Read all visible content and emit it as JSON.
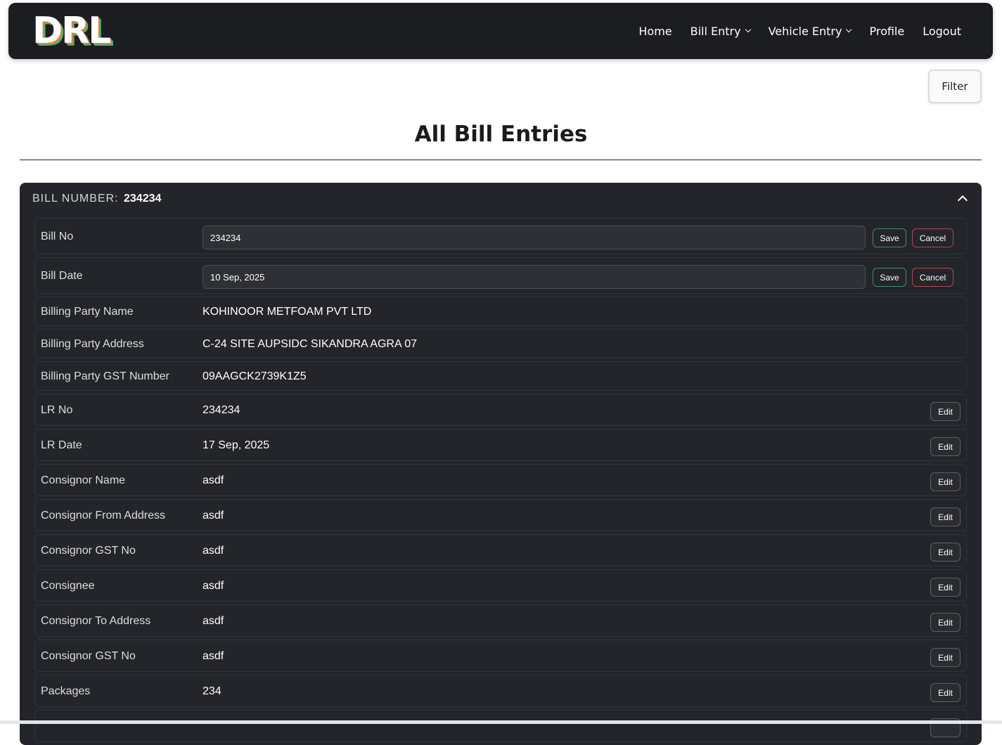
{
  "navbar": {
    "logo": "DRL",
    "links": [
      {
        "label": "Home",
        "dropdown": false
      },
      {
        "label": "Bill Entry",
        "dropdown": true
      },
      {
        "label": "Vehicle Entry",
        "dropdown": true
      },
      {
        "label": "Profile",
        "dropdown": false
      },
      {
        "label": "Logout",
        "dropdown": false
      }
    ]
  },
  "filter_label": "Filter",
  "page_title": "All Bill Entries",
  "card": {
    "header_label": "BILL NUMBER:",
    "header_value": "234234",
    "editing_rows": [
      {
        "label": "Bill No",
        "value": "234234",
        "save": "Save",
        "cancel": "Cancel"
      },
      {
        "label": "Bill Date",
        "value": "10 Sep, 2025",
        "save": "Save",
        "cancel": "Cancel"
      }
    ],
    "static_rows": [
      {
        "label": "Billing Party Name",
        "value": "KOHINOOR METFOAM PVT LTD"
      },
      {
        "label": "Billing Party Address",
        "value": "C-24 SITE AUPSIDC SIKANDRA AGRA 07"
      },
      {
        "label": "Billing Party GST Number",
        "value": "09AAGCK2739K1Z5"
      }
    ],
    "edit_rows": [
      {
        "label": "LR No",
        "value": "234234",
        "edit": "Edit"
      },
      {
        "label": "LR Date",
        "value": "17 Sep, 2025",
        "edit": "Edit"
      },
      {
        "label": "Consignor Name",
        "value": "asdf",
        "edit": "Edit"
      },
      {
        "label": "Consignor From Address",
        "value": "asdf",
        "edit": "Edit"
      },
      {
        "label": "Consignor GST No",
        "value": "asdf",
        "edit": "Edit"
      },
      {
        "label": "Consignee",
        "value": "asdf",
        "edit": "Edit"
      },
      {
        "label": "Consignor To Address",
        "value": "asdf",
        "edit": "Edit"
      },
      {
        "label": "Consignor GST No",
        "value": "asdf",
        "edit": "Edit"
      },
      {
        "label": "Packages",
        "value": "234",
        "edit": "Edit"
      },
      {
        "label": "",
        "value": "",
        "edit": ""
      }
    ]
  },
  "colors": {
    "navbar_bg": "#1c1d21",
    "card_bg": "#23252a",
    "save_border": "#3f8f6a",
    "cancel_border": "#a74b52",
    "logo_accent_orange": "#f07a3a",
    "logo_accent_green": "#3fb86b"
  }
}
